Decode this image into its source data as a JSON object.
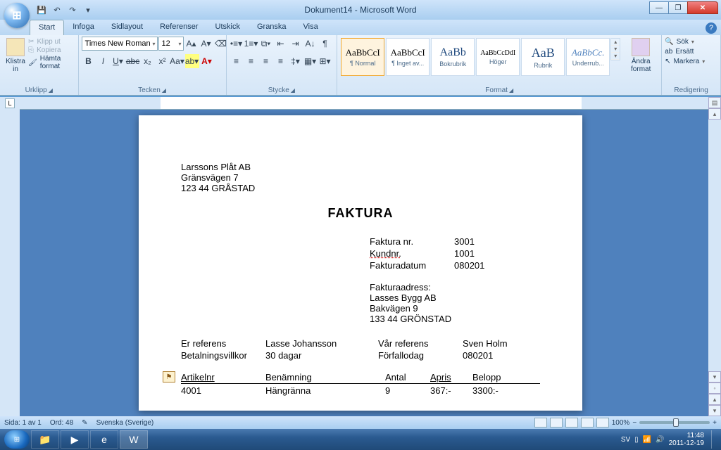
{
  "window": {
    "title": "Dokument14 - Microsoft Word"
  },
  "tabs": [
    "Start",
    "Infoga",
    "Sidlayout",
    "Referenser",
    "Utskick",
    "Granska",
    "Visa"
  ],
  "ribbon": {
    "clipboard": {
      "paste": "Klistra\nin",
      "cut": "Klipp ut",
      "copy": "Kopiera",
      "fmt": "Hämta format",
      "label": "Urklipp"
    },
    "font": {
      "name": "Times New Roman",
      "size": "12",
      "label": "Tecken"
    },
    "para": {
      "label": "Stycke"
    },
    "styles": {
      "label": "Format",
      "items": [
        {
          "sample": "AaBbCcI",
          "name": "¶ Normal"
        },
        {
          "sample": "AaBbCcI",
          "name": "¶ Inget av..."
        },
        {
          "sample": "AaBb",
          "name": "Bokrubrik"
        },
        {
          "sample": "AaBbCcDdI",
          "name": "Höger"
        },
        {
          "sample": "AaB",
          "name": "Rubrik"
        },
        {
          "sample": "AaBbCc.",
          "name": "Underrub..."
        }
      ],
      "change": "Ändra\nformat"
    },
    "edit": {
      "find": "Sök",
      "replace": "Ersätt",
      "select": "Markera",
      "label": "Redigering"
    }
  },
  "doc": {
    "company": "Larssons Plåt AB",
    "street": "Gränsvägen 7",
    "city": "123 44 GRÅSTAD",
    "heading": "FAKTURA",
    "meta": [
      {
        "l": "Faktura nr.",
        "v": "3001"
      },
      {
        "l": "Kundnr.",
        "v": "1001",
        "u": true
      },
      {
        "l": "Fakturadatum",
        "v": "080201"
      }
    ],
    "addrLabel": "Fakturaadress:",
    "addr": [
      "Lasses Bygg AB",
      "Bakvägen 9",
      "133 44 GRÖNSTAD"
    ],
    "refs": [
      {
        "c1": "Er referens",
        "c2": "Lasse Johansson",
        "c3": "Vår referens",
        "c4": "Sven Holm"
      },
      {
        "c1": "Betalningsvillkor",
        "c2": "30 dagar",
        "c3": "Förfallodag",
        "c4": "080201"
      }
    ],
    "thead": {
      "a": "Artikelnr",
      "b": "Benämning",
      "c": "Antal",
      "d": "Apris",
      "e": "Belopp"
    },
    "trow": {
      "a": "4001",
      "b": "Hängränna",
      "c": "9",
      "d": "367:-",
      "e": "3300:-"
    }
  },
  "status": {
    "page": "Sida: 1 av 1",
    "words": "Ord: 48",
    "lang": "Svenska (Sverige)",
    "zoom": "100%"
  },
  "taskbar": {
    "lang": "SV",
    "time": "11:48",
    "date": "2011-12-19"
  }
}
